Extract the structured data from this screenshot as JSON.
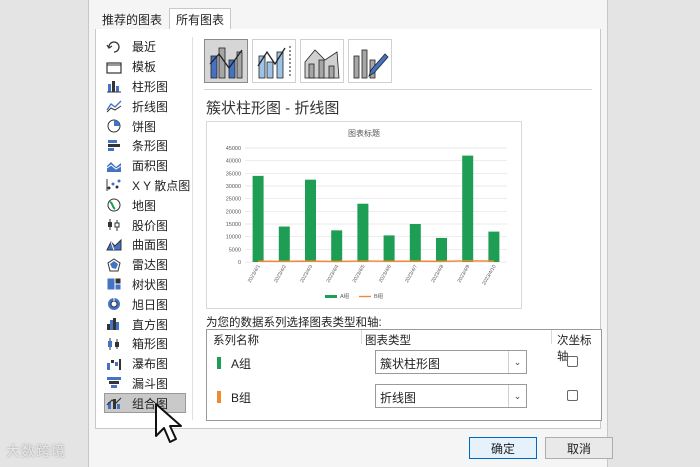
{
  "tabs": [
    {
      "label": "推荐的图表",
      "active": false
    },
    {
      "label": "所有图表",
      "active": true
    }
  ],
  "sidebar": {
    "items": [
      {
        "label": "最近",
        "icon": "recent-icon"
      },
      {
        "label": "模板",
        "icon": "folder-icon"
      },
      {
        "label": "柱形图",
        "icon": "column-chart-icon"
      },
      {
        "label": "折线图",
        "icon": "line-chart-icon"
      },
      {
        "label": "饼图",
        "icon": "pie-chart-icon"
      },
      {
        "label": "条形图",
        "icon": "bar-chart-icon"
      },
      {
        "label": "面积图",
        "icon": "area-chart-icon"
      },
      {
        "label": "X Y 散点图",
        "icon": "scatter-chart-icon"
      },
      {
        "label": "地图",
        "icon": "map-chart-icon"
      },
      {
        "label": "股价图",
        "icon": "stock-chart-icon"
      },
      {
        "label": "曲面图",
        "icon": "surface-chart-icon"
      },
      {
        "label": "雷达图",
        "icon": "radar-chart-icon"
      },
      {
        "label": "树状图",
        "icon": "treemap-chart-icon"
      },
      {
        "label": "旭日图",
        "icon": "sunburst-chart-icon"
      },
      {
        "label": "直方图",
        "icon": "histogram-chart-icon"
      },
      {
        "label": "箱形图",
        "icon": "boxplot-chart-icon"
      },
      {
        "label": "瀑布图",
        "icon": "waterfall-chart-icon"
      },
      {
        "label": "漏斗图",
        "icon": "funnel-chart-icon"
      },
      {
        "label": "组合图",
        "icon": "combo-chart-icon"
      }
    ],
    "selected_index": 18
  },
  "combo_type_title": "簇状柱形图 - 折线图",
  "assign_label": "为您的数据系列选择图表类型和轴:",
  "series_table": {
    "headers": [
      "系列名称",
      "图表类型",
      "次坐标轴"
    ],
    "rows": [
      {
        "name": "A组",
        "type": "簇状柱形图",
        "color": "#1e9e55",
        "secondary_axis": false
      },
      {
        "name": "B组",
        "type": "折线图",
        "color": "#f08a30",
        "secondary_axis": false
      }
    ]
  },
  "buttons": {
    "ok": "确定",
    "cancel": "取消"
  },
  "watermark": "大数跨境",
  "colors": {
    "accent": "#0067c0",
    "bar": "#1e9e55",
    "line": "#f08a30"
  },
  "chart_data": {
    "type": "bar",
    "title": "图表标题",
    "categories": [
      "2023/4/1",
      "2023/4/2",
      "2023/4/3",
      "2023/4/4",
      "2023/4/5",
      "2023/4/6",
      "2023/4/7",
      "2023/4/8",
      "2023/4/9",
      "2023/4/10"
    ],
    "series": [
      {
        "name": "A组",
        "chart": "bar",
        "values": [
          34000,
          14000,
          32500,
          12500,
          23000,
          10500,
          15000,
          9500,
          42000,
          12000
        ]
      },
      {
        "name": "B组",
        "chart": "line",
        "values": [
          300,
          250,
          350,
          200,
          400,
          300,
          350,
          250,
          450,
          350
        ]
      }
    ],
    "yticks": [
      "0",
      "5000",
      "10000",
      "15000",
      "20000",
      "25000",
      "30000",
      "35000",
      "40000",
      "45000"
    ],
    "ylim": [
      0,
      45000
    ],
    "grid": true,
    "legend": "bottom"
  }
}
